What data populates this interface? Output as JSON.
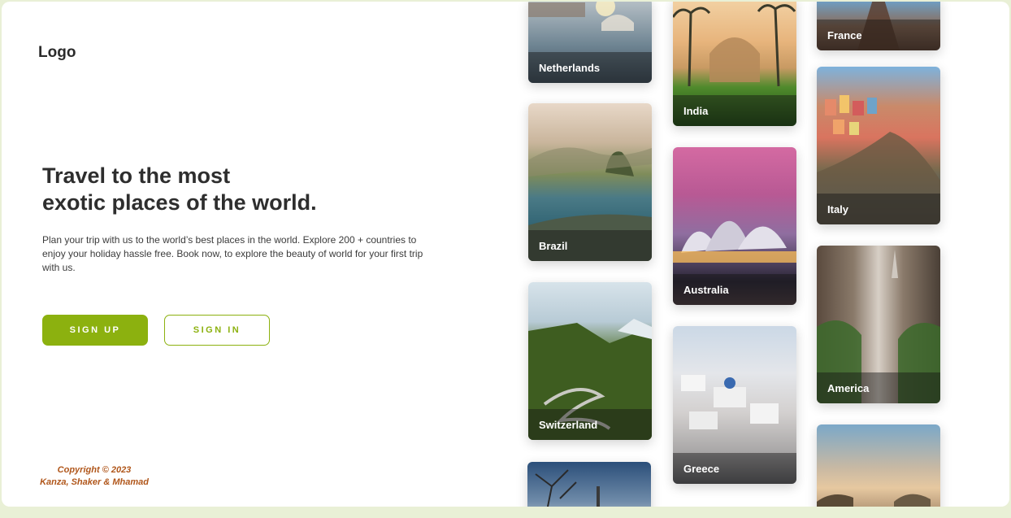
{
  "header": {
    "logo": "Logo"
  },
  "hero": {
    "title_line1": "Travel to the most",
    "title_line2": "exotic places of the world.",
    "description": "Plan your trip with us to the world’s best places in the world. Explore 200 + countries to enjoy your holiday hassle free. Book now, to explore the beauty of world for your first trip with us.",
    "signup_label": "SIGN UP",
    "signin_label": "SIGN IN"
  },
  "footer": {
    "copyright_line1": "Copyright © 2023",
    "copyright_line2": "Kanza, Shaker & Mhamad"
  },
  "colors": {
    "accent": "#8cb10f",
    "copyright": "#b0561a",
    "page_background": "#e9f0d6"
  },
  "destinations": {
    "netherlands": "Netherlands",
    "india": "India",
    "france": "France",
    "brazil": "Brazil",
    "australia": "Australia",
    "italy": "Italy",
    "switzerland": "Switzerland",
    "greece": "Greece",
    "america": "America"
  }
}
